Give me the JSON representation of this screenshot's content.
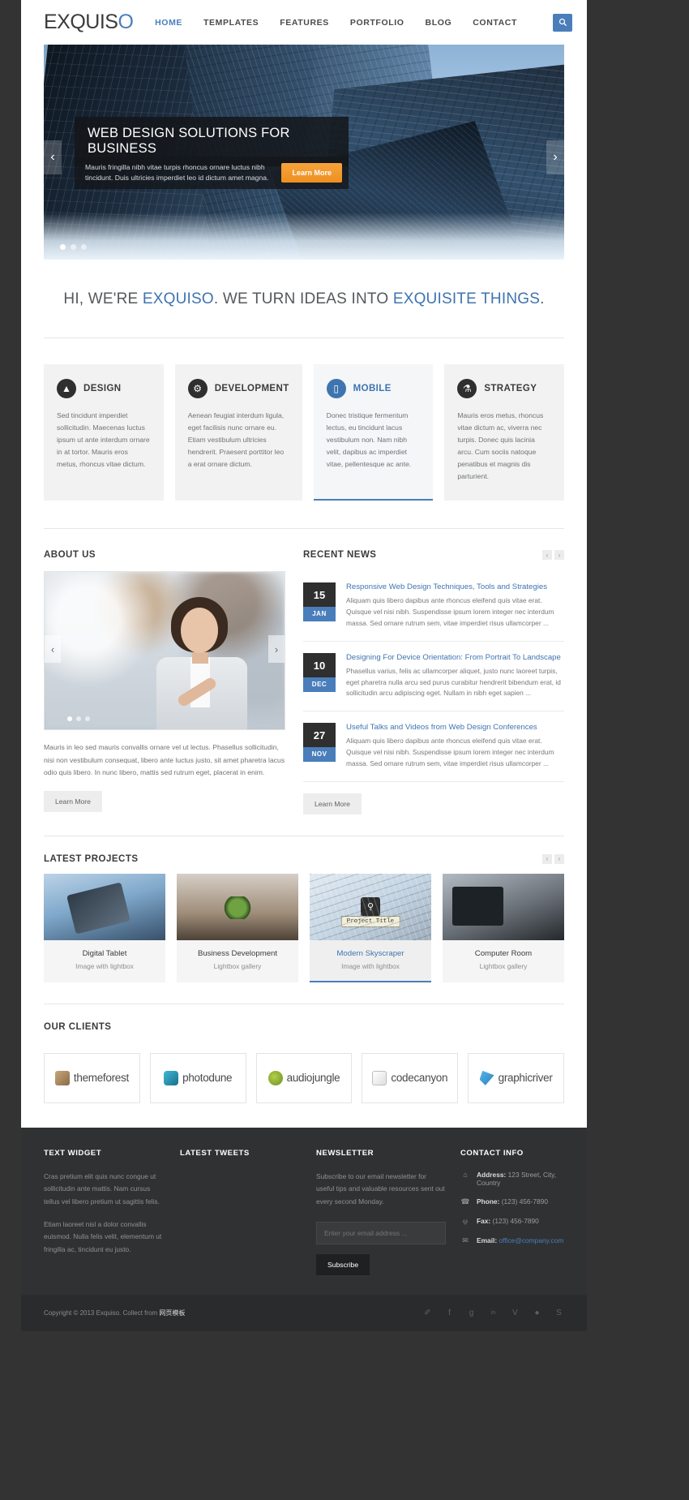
{
  "brand": {
    "name_main": "EXQUIS",
    "name_accent": "O"
  },
  "nav": {
    "items": [
      {
        "label": "HOME",
        "active": true
      },
      {
        "label": "TEMPLATES",
        "active": false
      },
      {
        "label": "FEATURES",
        "active": false
      },
      {
        "label": "PORTFOLIO",
        "active": false
      },
      {
        "label": "BLOG",
        "active": false
      },
      {
        "label": "CONTACT",
        "active": false
      }
    ],
    "search_icon": "search-icon"
  },
  "slider": {
    "title": "WEB DESIGN SOLUTIONS FOR BUSINESS",
    "body": "Mauris fringilla nibh vitae turpis rhoncus ornare luctus nibh tincidunt. Duis ultricies imperdiet leo id dictum amet magna.",
    "cta": "Learn More",
    "prev": "‹",
    "next": "›",
    "dots": 3,
    "active_dot": 0
  },
  "tagline": {
    "p1": "HI, WE'RE ",
    "h1": "EXQUISO",
    "p2": ". WE TURN IDEAS INTO ",
    "h2": "EXQUISITE THINGS",
    "p3": "."
  },
  "services": [
    {
      "title": "DESIGN",
      "icon": "compass-icon",
      "glyph": "▲",
      "body": "Sed tincidunt imperdiet sollicitudin. Maecenas luctus ipsum ut ante interdum ornare in at tortor. Mauris eros metus, rhoncus vitae dictum.",
      "active": false
    },
    {
      "title": "DEVELOPMENT",
      "icon": "gear-icon",
      "glyph": "⚙",
      "body": "Aenean feugiat interdum ligula, eget facilisis nunc ornare eu. Etiam vestibulum ultricies hendrerit. Praesent porttitor leo a erat ornare dictum.",
      "active": false
    },
    {
      "title": "MOBILE",
      "icon": "mobile-icon",
      "glyph": "▯",
      "body": "Donec tristique fermentum lectus, eu tincidunt lacus vestibulum non. Nam nibh velit, dapibus ac imperdiet vitae, pellentesque ac ante.",
      "active": true
    },
    {
      "title": "STRATEGY",
      "icon": "flask-icon",
      "glyph": "⚗",
      "body": "Mauris eros metus, rhoncus vitae dictum ac, viverra nec turpis. Donec quis lacinia arcu. Cum sociis natoque penatibus et magnis dis parturient.",
      "active": false
    }
  ],
  "about": {
    "title": "ABOUT US",
    "prev": "‹",
    "next": "›",
    "dots": 3,
    "active_dot": 0,
    "text": "Mauris in leo sed mauris convallis ornare vel ut lectus. Phasellus sollicitudin, nisi non vestibulum consequat, libero ante luctus justo, sit amet pharetra lacus odio quis libero. In nunc libero, mattis sed rutrum eget, placerat in enim.",
    "cta": "Learn More"
  },
  "news": {
    "title": "RECENT NEWS",
    "nav_prev": "‹",
    "nav_next": "›",
    "cta": "Learn More",
    "items": [
      {
        "day": "15",
        "month": "JAN",
        "headline": "Responsive Web Design Techniques, Tools and Strategies",
        "body": "Aliquam quis libero dapibus ante rhoncus eleifend quis vitae erat. Quisque vel nisi nibh. Suspendisse ipsum lorem integer nec interdum massa. Sed ornare rutrum sem, vitae imperdiet risus ullamcorper ..."
      },
      {
        "day": "10",
        "month": "DEC",
        "headline": "Designing For Device Orientation: From Portrait To Landscape",
        "body": "Phasellus varius, felis ac ullamcorper aliquet, justo nunc laoreet turpis, eget pharetra nulla arcu sed purus curabitur hendrerit bibendum erat, id sollicitudin arcu adipiscing eget. Nullam in nibh eget sapien ..."
      },
      {
        "day": "27",
        "month": "NOV",
        "headline": "Useful Talks and Videos from Web Design Conferences",
        "body": "Aliquam quis libero dapibus ante rhoncus eleifend quis vitae erat. Quisque vel nisi nibh. Suspendisse ipsum lorem integer nec interdum massa. Sed ornare rutrum sem, vitae imperdiet risus ullamcorper ..."
      }
    ]
  },
  "projects": {
    "title": "LATEST PROJECTS",
    "nav_prev": "‹",
    "nav_next": "›",
    "tooltip": "Project Title",
    "zoom_icon": "magnifier-icon",
    "items": [
      {
        "title": "Digital Tablet",
        "sub": "Image with lightbox",
        "active": false
      },
      {
        "title": "Business Development",
        "sub": "Lightbox gallery",
        "active": false
      },
      {
        "title": "Modern Skyscraper",
        "sub": "Image with lightbox",
        "active": true
      },
      {
        "title": "Computer Room",
        "sub": "Lightbox gallery",
        "active": false
      }
    ]
  },
  "clients": {
    "title": "OUR CLIENTS",
    "items": [
      {
        "name": "themeforest",
        "icon": "themeforest-icon"
      },
      {
        "name": "photodune",
        "icon": "photodune-icon"
      },
      {
        "name": "audiojungle",
        "icon": "audiojungle-icon"
      },
      {
        "name": "codecanyon",
        "icon": "codecanyon-icon"
      },
      {
        "name": "graphicriver",
        "icon": "graphicriver-icon"
      }
    ]
  },
  "footer": {
    "text_widget": {
      "title": "TEXT WIDGET",
      "p1": "Cras pretium elit quis nunc congue ut sollicitudin ante mattis. Nam cursus tellus vel libero pretium ut sagittis felis.",
      "p2": "Etiam laoreet nisl a dolor convallis euismod. Nulla felis velit, elementum ut fringilla ac, tincidunt eu justo."
    },
    "tweets": {
      "title": "LATEST TWEETS"
    },
    "newsletter": {
      "title": "NEWSLETTER",
      "body": "Subscribe to our email newsletter for useful tips and valuable resources sent out every second Monday.",
      "placeholder": "Enter your email address ...",
      "input_value": "",
      "button": "Subscribe"
    },
    "contact": {
      "title": "CONTACT INFO",
      "rows": [
        {
          "icon": "home-icon",
          "glyph": "⌂",
          "label": "Address:",
          "value": "123 Street, City, Country",
          "link": false
        },
        {
          "icon": "phone-icon",
          "glyph": "☎",
          "label": "Phone:",
          "value": "(123) 456-7890",
          "link": false
        },
        {
          "icon": "fax-icon",
          "glyph": "⎙",
          "label": "Fax:",
          "value": "(123) 456-7890",
          "link": false
        },
        {
          "icon": "mail-icon",
          "glyph": "✉",
          "label": "Email:",
          "value": "office@company.com",
          "link": true
        }
      ]
    }
  },
  "subfooter": {
    "copyright_pre": "Copyright © 2013 Exquiso. Collect from ",
    "copyright_cn": "网页模板",
    "socials": [
      {
        "name": "twitter-icon",
        "glyph": "✐"
      },
      {
        "name": "facebook-icon",
        "glyph": "f"
      },
      {
        "name": "googleplus-icon",
        "glyph": "g"
      },
      {
        "name": "linkedin-icon",
        "glyph": "in"
      },
      {
        "name": "vimeo-icon",
        "glyph": "V"
      },
      {
        "name": "dribbble-icon",
        "glyph": "●"
      },
      {
        "name": "skype-icon",
        "glyph": "S"
      }
    ]
  }
}
